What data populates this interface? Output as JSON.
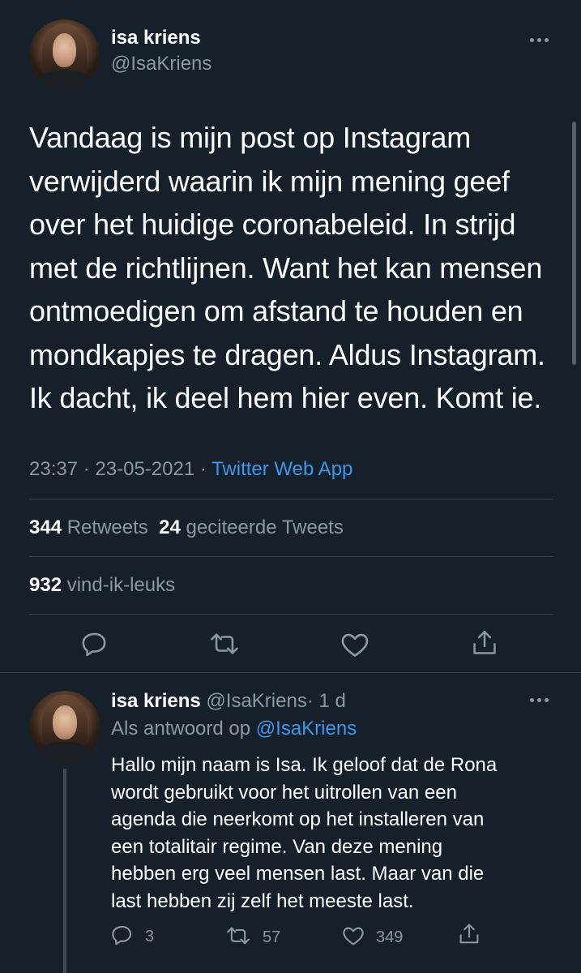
{
  "main_tweet": {
    "author_name": "isa kriens",
    "author_handle": "@IsaKriens",
    "text_lines": [
      "Vandaag is mijn post op Instagram",
      "verwijderd waarin ik mijn mening geef",
      "over het huidige coronabeleid. In strijd",
      "met de richtlijnen. Want het kan mensen",
      "ontmoedigen om afstand te houden en",
      "mondkapjes te dragen. Aldus Instagram.",
      "Ik dacht, ik deel hem hier even. Komt ie."
    ],
    "time": "23:37",
    "date": "23-05-2021",
    "separator": "·",
    "source": "Twitter Web App",
    "retweets_count": "344",
    "retweets_label": "Retweets",
    "quotes_count": "24",
    "quotes_label": "geciteerde Tweets",
    "likes_count": "932",
    "likes_label": "vind-ik-leuks"
  },
  "reply_tweet": {
    "author_name": "isa kriens",
    "author_handle": "@IsaKriens",
    "age": "· 1 d",
    "reply_prefix": "Als antwoord op",
    "reply_to": "@IsaKriens",
    "text_lines": [
      "Hallo mijn naam is Isa. Ik geloof dat de Rona",
      "wordt gebruikt voor het uitrollen van een",
      "agenda die neerkomt op het installeren van",
      "een totalitair regime. Van deze mening",
      "hebben erg veel mensen last. Maar van die",
      "last hebben zij zelf het meeste last."
    ],
    "reply_count": "3",
    "retweet_count": "57",
    "like_count": "349"
  },
  "icons": [
    "more-icon",
    "reply-icon",
    "retweet-icon",
    "like-icon",
    "share-icon"
  ],
  "colors": {
    "background": "#15202b",
    "text": "#ffffff",
    "muted": "#8b98a5",
    "link": "#3a99e8",
    "divider": "#38444d"
  }
}
